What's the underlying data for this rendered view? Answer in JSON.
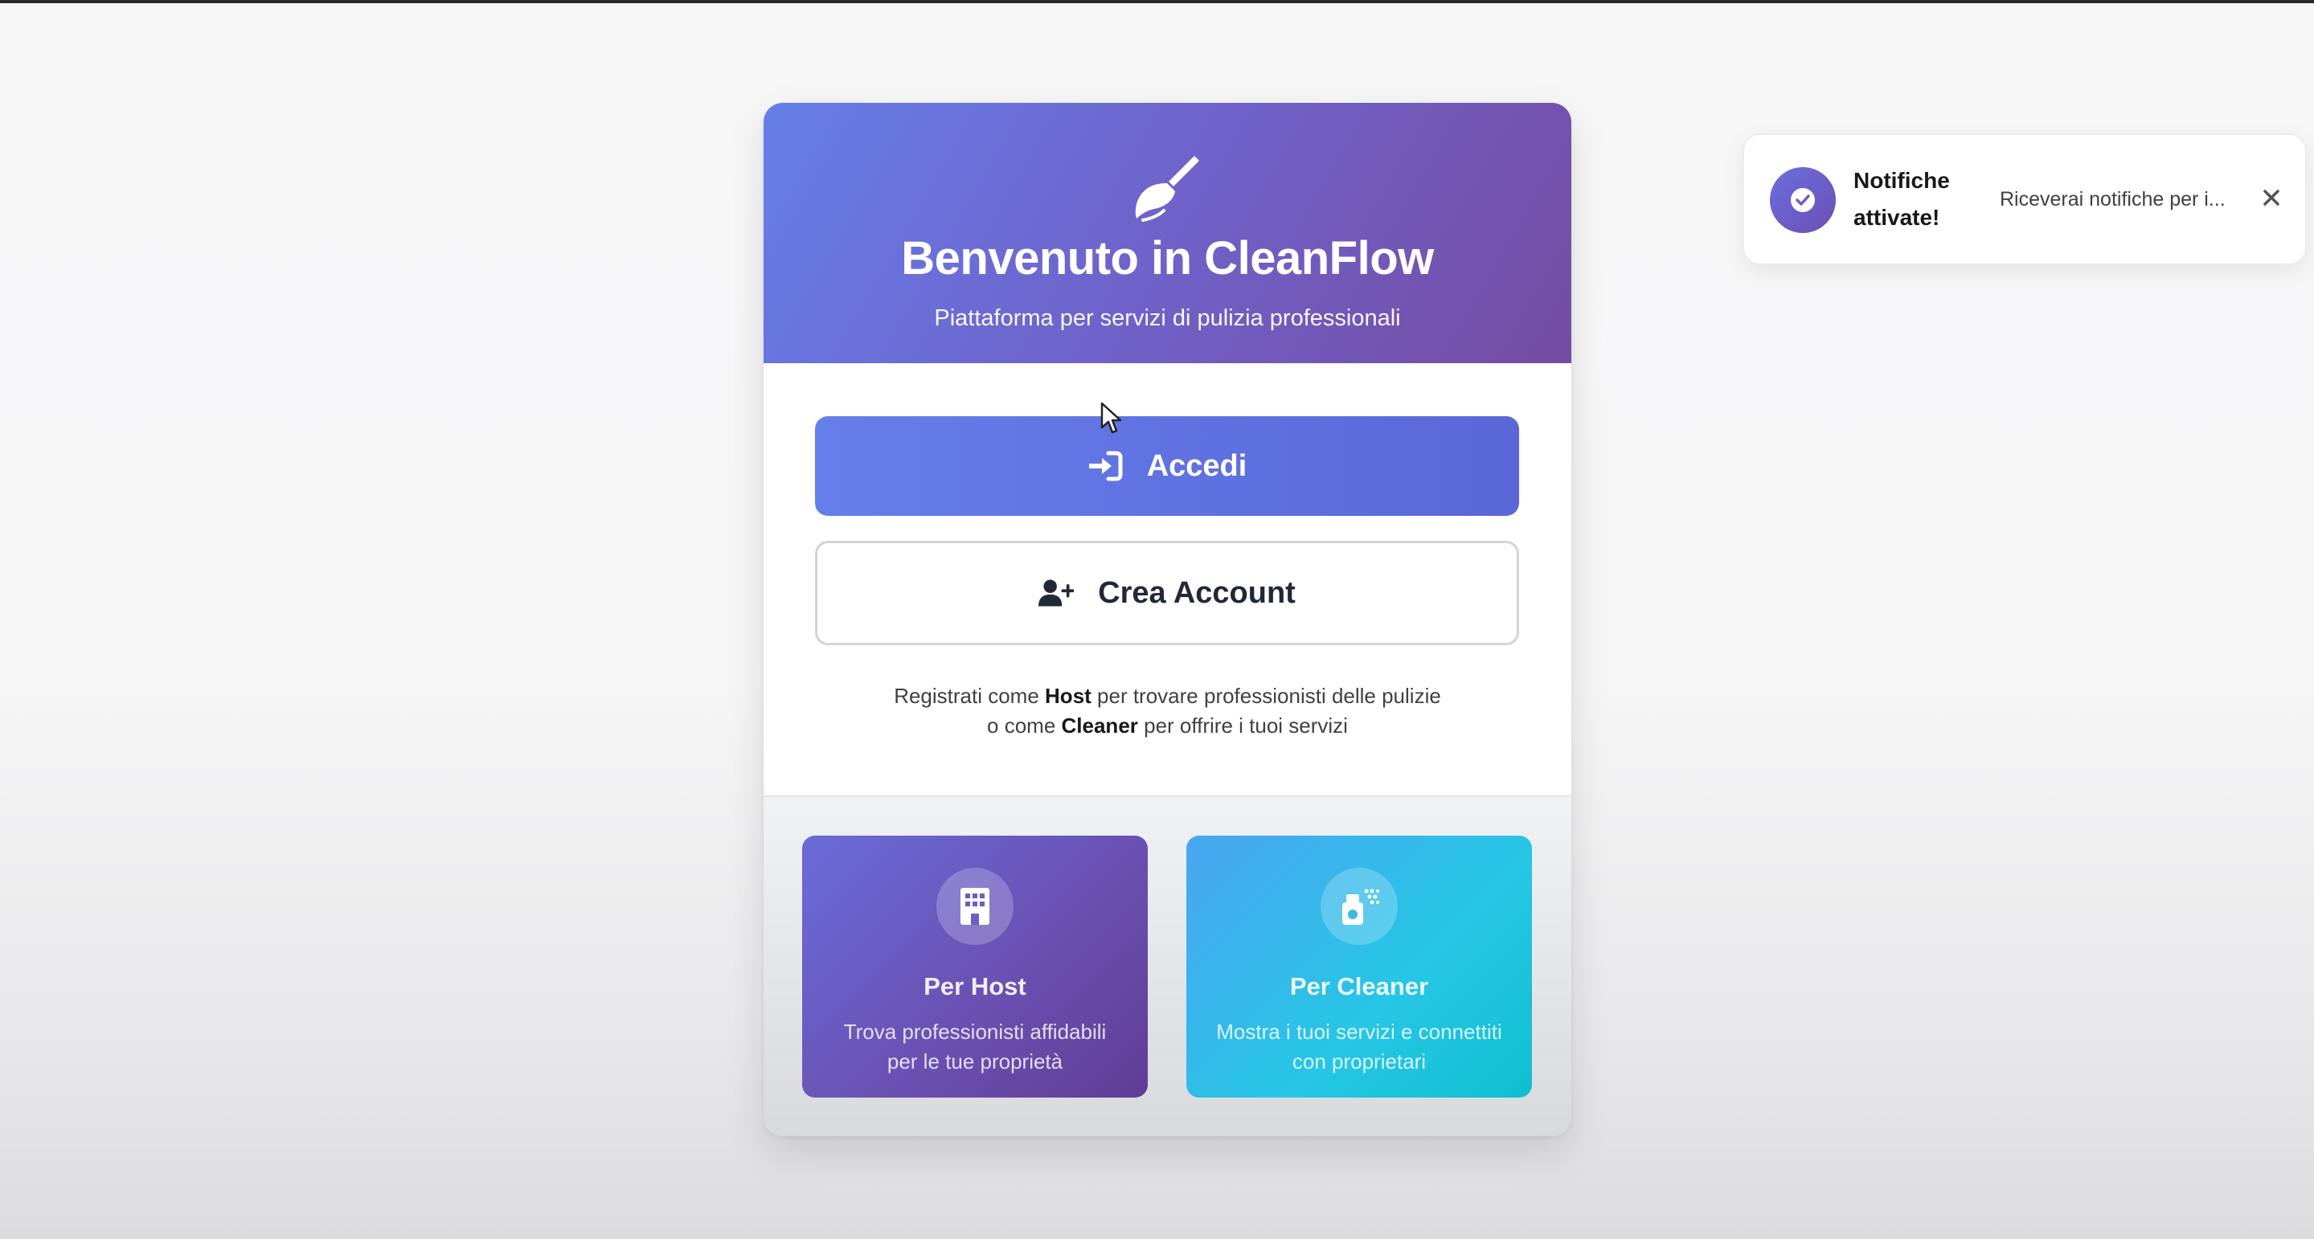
{
  "header": {
    "icon": "broom-icon",
    "title": "Benvenuto in CleanFlow",
    "subtitle": "Piattaforma per servizi di pulizia professionali"
  },
  "actions": {
    "login": {
      "icon": "sign-in-icon",
      "label": "Accedi"
    },
    "register": {
      "icon": "user-plus-icon",
      "label": "Crea Account"
    }
  },
  "info": {
    "line1_prefix": "Registrati come ",
    "line1_bold": "Host",
    "line1_suffix": " per trovare professionisti delle pulizie",
    "line2_prefix": "o come ",
    "line2_bold": "Cleaner",
    "line2_suffix": " per offrire i tuoi servizi"
  },
  "features": [
    {
      "icon": "building-icon",
      "title": "Per Host",
      "description": "Trova professionisti affidabili per le tue proprietà"
    },
    {
      "icon": "spray-bottle-icon",
      "title": "Per Cleaner",
      "description": "Mostra i tuoi servizi e connettiti con proprietari"
    }
  ],
  "toast": {
    "icon": "check-circle-icon",
    "title": "Notifiche attivate!",
    "message": "Riceverai notifiche per i...",
    "close_icon": "close-icon"
  },
  "colors": {
    "primary": "#667eea",
    "secondary": "#764ba2",
    "cleaner_accent": "#26c6e6"
  }
}
